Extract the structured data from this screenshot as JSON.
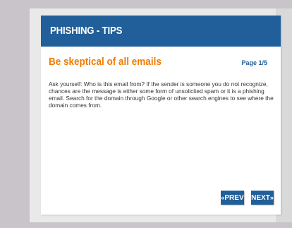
{
  "header": {
    "title": "PHISHING - TIPS"
  },
  "content": {
    "heading": "Be skeptical of all emails",
    "page_label": "Page 1/5",
    "body": "Ask yourself: Who is this email from? If the sender is someone you do not recognize, chances are the message is either some form of unsolicited spam or it is a phishing email. Search for the domain through Google or other search engines to see where the domain comes from."
  },
  "nav": {
    "prev_arrow": "«",
    "prev_label": "PREV",
    "next_label": "NEXT",
    "next_arrow": "»"
  },
  "colors": {
    "header_bg": "#215f9a",
    "heading": "#f07d00",
    "page_bg": "#c9c3ca"
  }
}
